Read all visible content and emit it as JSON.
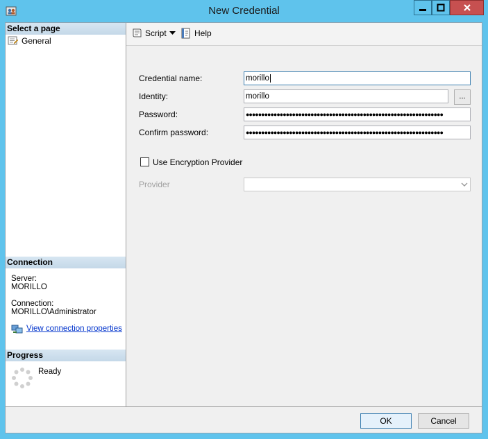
{
  "window": {
    "title": "New Credential"
  },
  "sidebar": {
    "select_page_header": "Select a page",
    "pages": [
      {
        "label": "General"
      }
    ],
    "connection_header": "Connection",
    "server_label": "Server:",
    "server_value": "MORILLO",
    "connection_label": "Connection:",
    "connection_value": "MORILLO\\Administrator",
    "view_connection_link": "View connection properties",
    "progress_header": "Progress",
    "progress_status": "Ready"
  },
  "toolbar": {
    "script_label": "Script",
    "help_label": "Help"
  },
  "form": {
    "credential_name_label": "Credential name:",
    "credential_name_value": "morillo",
    "identity_label": "Identity:",
    "identity_value": "morillo",
    "browse_label": "...",
    "password_label": "Password:",
    "password_value": "●●●●●●●●●●●●●●●●●●●●●●●●●●●●●●●●●●●●●●●●●●●●●●●●●●●●●●●●●●●●●●●●",
    "confirm_password_label": "Confirm password:",
    "confirm_password_value": "●●●●●●●●●●●●●●●●●●●●●●●●●●●●●●●●●●●●●●●●●●●●●●●●●●●●●●●●●●●●●●●●",
    "use_encryption_label": "Use Encryption Provider",
    "use_encryption_checked": false,
    "provider_label": "Provider",
    "provider_value": ""
  },
  "footer": {
    "ok_label": "OK",
    "cancel_label": "Cancel"
  },
  "colors": {
    "titlebar": "#5fc3ec",
    "close_button": "#c75050",
    "link": "#0033cc"
  }
}
